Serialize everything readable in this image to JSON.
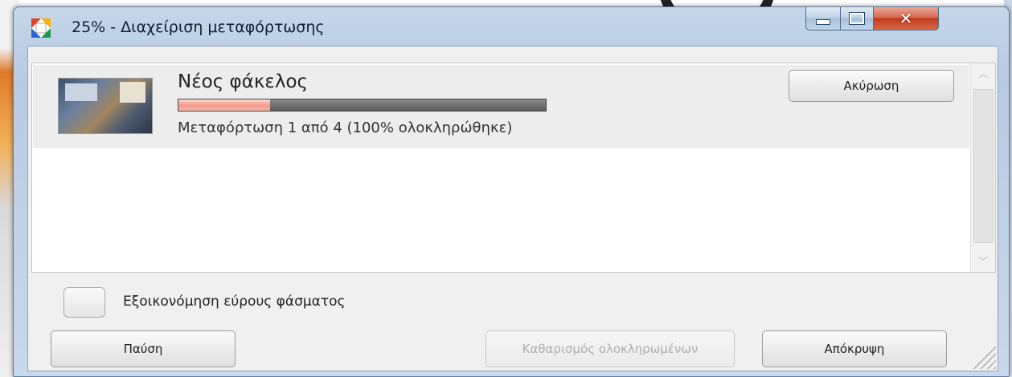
{
  "window": {
    "title": "25% - Διαχείριση μεταφόρτωσης",
    "icon": "picasa-icon",
    "minimize_icon": "minimize-icon",
    "maximize_icon": "maximize-icon",
    "close_icon": "close-icon",
    "close_glyph": "✕"
  },
  "upload_list": {
    "items": [
      {
        "name": "Νέος φάκελος",
        "status": "Μεταφόρτωση 1 από 4 (100% ολοκληρώθηκε)",
        "progress": 0.25,
        "cancel_label": "Ακύρωση"
      }
    ]
  },
  "options": {
    "bandwidth_checkbox_label": "Εξοικονόμηση εύρους φάσματος",
    "bandwidth_checked": false
  },
  "buttons": {
    "pause": "Παύση",
    "clear_completed": "Καθαρισμός ολοκληρωμένων",
    "hide": "Απόκρυψη"
  },
  "colors": {
    "progress_fill": "#f39a8c",
    "progress_track": "#5a5a5a",
    "close_button": "#c13a1c"
  }
}
